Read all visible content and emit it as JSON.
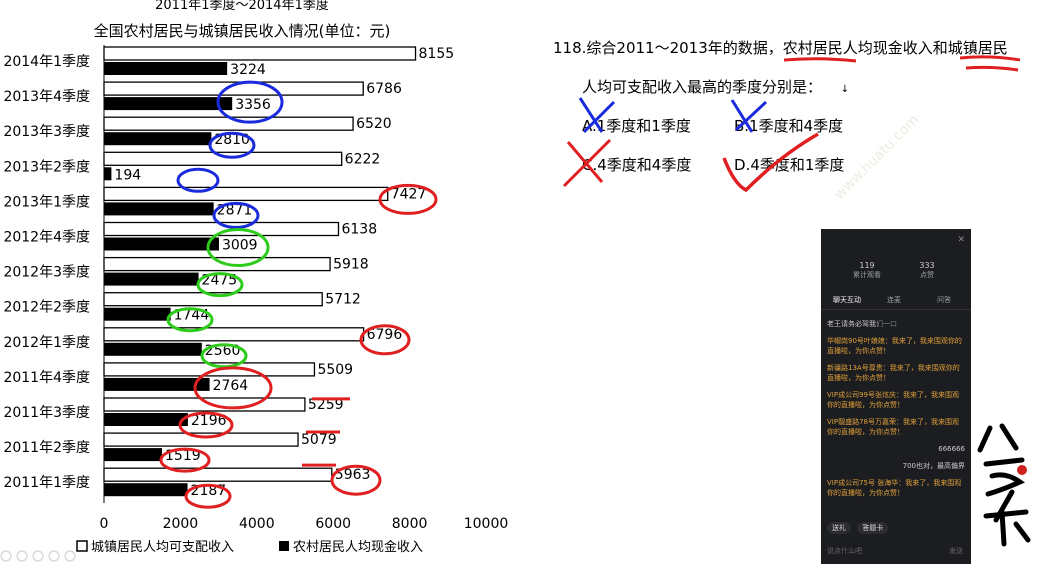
{
  "chart_data": {
    "type": "bar",
    "orientation": "horizontal",
    "title": "2011年1季度～2014年1季度",
    "subtitle": "全国农村居民与城镇居民收入情况(单位：元)",
    "categories": [
      "2014年1季度",
      "2013年4季度",
      "2013年3季度",
      "2013年2季度",
      "2013年1季度",
      "2012年4季度",
      "2012年3季度",
      "2012年2季度",
      "2012年1季度",
      "2011年4季度",
      "2011年3季度",
      "2011年2季度",
      "2011年1季度"
    ],
    "series": [
      {
        "name": "城镇居民人均可支配收入",
        "color": "#ffffff",
        "values": [
          8155,
          6786,
          6520,
          6222,
          7427,
          6138,
          5918,
          5712,
          6796,
          5509,
          5259,
          5079,
          5963
        ]
      },
      {
        "name": "农村居民人均现金收入",
        "color": "#000000",
        "values": [
          3224,
          3356,
          2810,
          194,
          2871,
          3009,
          2475,
          1744,
          2560,
          2764,
          2196,
          1519,
          2187
        ]
      }
    ],
    "xlim": [
      0,
      10000
    ],
    "xticks": [
      "0",
      "2000",
      "4000",
      "6000",
      "8000",
      "10000"
    ],
    "legend_position": "bottom",
    "data_labels": true
  },
  "question": {
    "line1_prefix": "118.综合2011～2013年的数据，",
    "line1_u1": "农村居民人均现金收入",
    "line1_mid": "和",
    "line1_u2": "城镇居民",
    "line2": "人均可支配收入最高的季度分别是：",
    "cursor": "↓",
    "options": [
      {
        "key": "A",
        "text": "A.1季度和1季度"
      },
      {
        "key": "B",
        "text": "B.1季度和4季度"
      },
      {
        "key": "C",
        "text": "C.4季度和4季度"
      },
      {
        "key": "D",
        "text": "D.4季度和1季度"
      }
    ]
  },
  "panel": {
    "close": "✕",
    "stat1_num": "119",
    "stat1_label": "累计观看",
    "stat2_num": "333",
    "stat2_label": "点赞",
    "tab1": "聊天互动",
    "tab2": "连麦",
    "tab3": "问答",
    "first_msg_user": "老王请务必驾我",
    "first_msg_text": "们一口",
    "messages": [
      "华帽岗90号叶娘娘：我来了，我来围观你的直播啦，为你点赞！",
      "新疆路13A号尊贵：我来了，我来围观你的直播啦，为你点赞！",
      "VIP成公司99号张炫庆：我来了，我来围观你的直播啦，为你点赞！",
      "VIP靓盛路78号万嘉荣：我来了，我来围观你的直播啦，为你点赞！"
    ],
    "sys1": "666666",
    "sys2_a": "700也对，最高偏界",
    "last_msg": "VIP成公司75号 张海华：我来了，我来围观你的直播啦，为你点赞！",
    "btn1": "送礼",
    "btn2": "答题卡",
    "input_placeholder": "说点什么吧",
    "send": "发送"
  },
  "logo_text": "公考思维",
  "watermark": "www.huatu.com"
}
